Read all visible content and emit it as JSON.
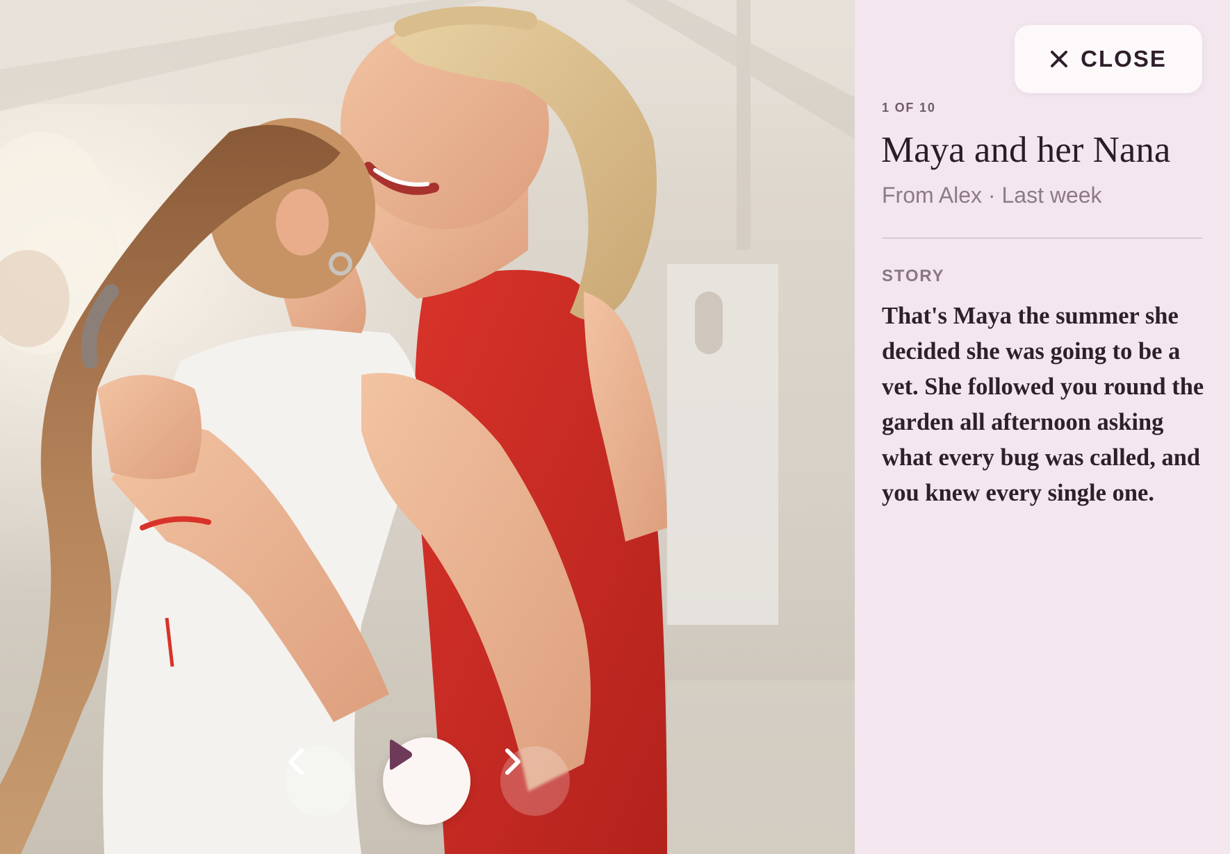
{
  "viewer": {
    "counter": "1 OF 10",
    "title": "Maya and her Nana",
    "meta": "From Alex · Last week",
    "close_label": "CLOSE",
    "story_label": "STORY",
    "story_text": "That's Maya the summer she decided she was going to be a vet. She followed you round the garden all afternoon asking what every bug was called, and you knew every single one."
  },
  "controls": {
    "prev_icon": "chevron-left-icon",
    "play_icon": "play-icon",
    "next_icon": "chevron-right-icon",
    "close_icon": "close-icon"
  },
  "colors": {
    "panel_bg": "#f3e6ee",
    "accent": "#6e3a5a",
    "title_text": "#2a1c26",
    "muted_text": "#8d7a86"
  }
}
